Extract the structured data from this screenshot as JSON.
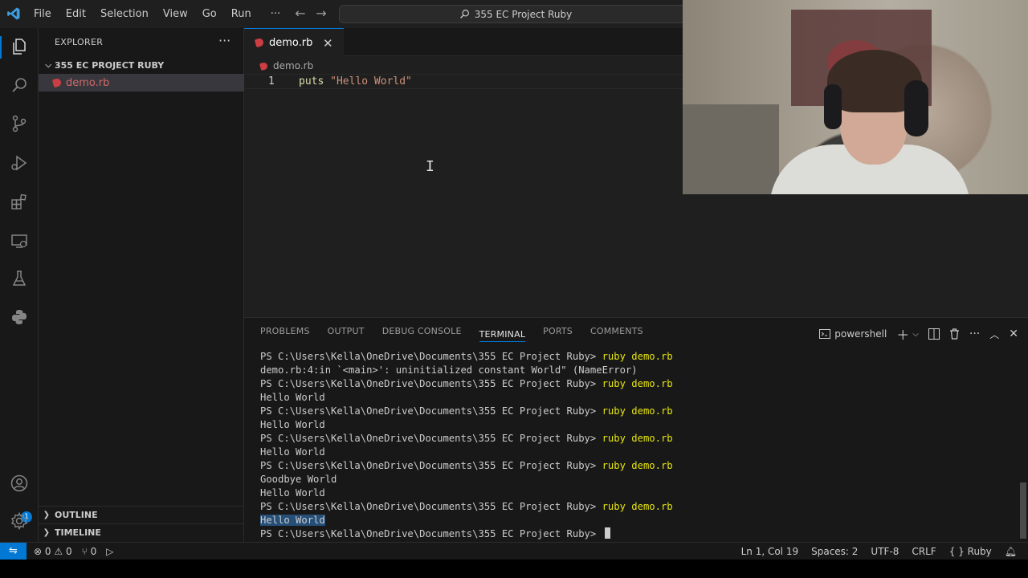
{
  "menu": [
    "File",
    "Edit",
    "Selection",
    "View",
    "Go",
    "Run",
    "···"
  ],
  "search": {
    "text": "355 EC Project Ruby"
  },
  "sidebar": {
    "title": "EXPLORER",
    "more": "···",
    "folder": "355 EC PROJECT RUBY",
    "file": "demo.rb",
    "outline": "OUTLINE",
    "timeline": "TIMELINE"
  },
  "editor": {
    "tab_label": "demo.rb",
    "close": "✕",
    "breadcrumb": "demo.rb",
    "line_number": "1",
    "code_keyword": "puts",
    "code_string": "\"Hello World\""
  },
  "activity": {
    "accounts_badge": "1"
  },
  "panel": {
    "tabs": [
      "PROBLEMS",
      "OUTPUT",
      "DEBUG CONSOLE",
      "TERMINAL",
      "PORTS",
      "COMMENTS"
    ],
    "active_tab": "TERMINAL",
    "shell": "powershell"
  },
  "terminal": {
    "prompt": "PS C:\\Users\\Kella\\OneDrive\\Documents\\355 EC Project Ruby> ",
    "command": "ruby demo.rb",
    "lines": [
      {
        "type": "cmd"
      },
      {
        "type": "out",
        "text": "demo.rb:4:in `<main>': uninitialized constant World\" (NameError)"
      },
      {
        "type": "cmd"
      },
      {
        "type": "out",
        "text": "Hello World"
      },
      {
        "type": "cmd"
      },
      {
        "type": "out",
        "text": "Hello World"
      },
      {
        "type": "cmd"
      },
      {
        "type": "out",
        "text": "Hello World"
      },
      {
        "type": "cmd"
      },
      {
        "type": "out",
        "text": "Goodbye World"
      },
      {
        "type": "out",
        "text": "Hello World"
      },
      {
        "type": "cmd"
      },
      {
        "type": "hl",
        "text": "Hello World"
      },
      {
        "type": "prompt"
      }
    ]
  },
  "status": {
    "errors": "0",
    "warnings": "0",
    "ports": "0",
    "position": "Ln 1, Col 19",
    "spaces": "Spaces: 2",
    "encoding": "UTF-8",
    "eol": "CRLF",
    "language": "Ruby"
  },
  "colors": {
    "accent": "#0078d4",
    "ruby": "#cc3e44",
    "terminal_command": "#e5e510"
  }
}
